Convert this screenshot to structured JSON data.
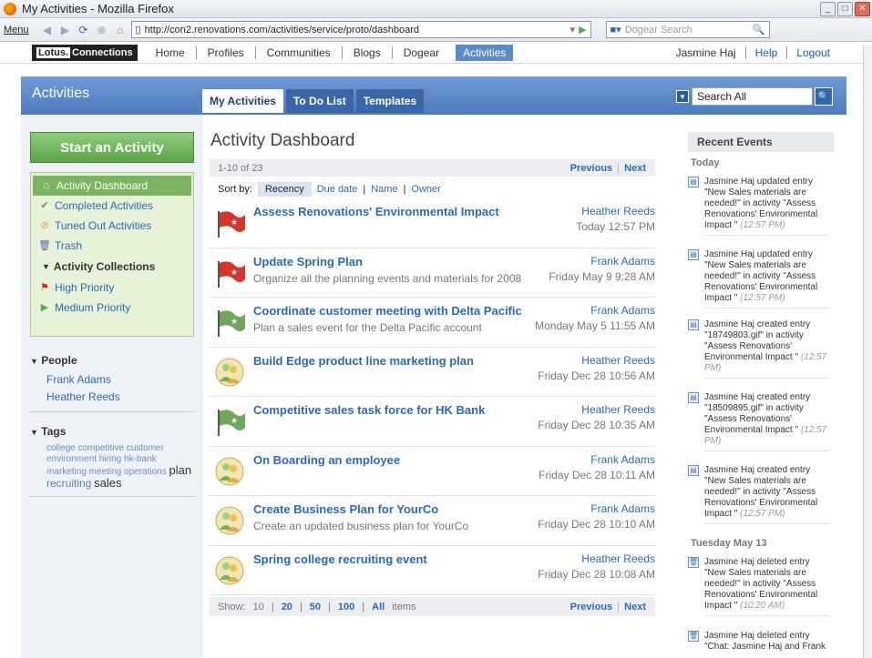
{
  "window": {
    "title": "My Activities - Mozilla Firefox"
  },
  "browser": {
    "menu": "Menu",
    "url": "http://con2.renovations.com/activities/service/proto/dashboard",
    "search_placeholder": "Dogear Search"
  },
  "topnav": {
    "brand_lotus": "Lotus.",
    "brand_name": "Connections",
    "items": [
      "Home",
      "Profiles",
      "Communities",
      "Blogs",
      "Dogear",
      "Activities"
    ],
    "user": "Jasmine Haj",
    "help": "Help",
    "logout": "Logout"
  },
  "banner": {
    "title": "Activities",
    "tabs": [
      "My Activities",
      "To Do List",
      "Templates"
    ],
    "search_value": "Search All"
  },
  "left": {
    "start_label": "Start an Activity",
    "nav": [
      "Activity Dashboard",
      "Completed Activities",
      "Tuned Out Activities",
      "Trash"
    ],
    "collections_header": "Activity Collections",
    "collections": [
      "High Priority",
      "Medium Priority"
    ],
    "people_header": "People",
    "people": [
      "Frank Adams",
      "Heather Reeds"
    ],
    "tags_header": "Tags",
    "tags_small": "college competitive customer environment hiring hk-bank marketing meeting operations",
    "tags_big1": "plan",
    "tags_mid": "recruiting",
    "tags_big2": "sales"
  },
  "main": {
    "title": "Activity Dashboard",
    "range": "1-10 of 23",
    "previous": "Previous",
    "next": "Next",
    "sort_label": "Sort by:",
    "sort_options": [
      "Recency",
      "Due date",
      "Name",
      "Owner"
    ],
    "rows": [
      {
        "title": "Assess Renovations' Environmental Impact",
        "desc": "",
        "owner": "Heather Reeds",
        "date": "Today 12:57 PM",
        "icon": "red-flag"
      },
      {
        "title": "Update Spring Plan",
        "desc": "Organize all the planning events and materials for 2008",
        "owner": "Frank Adams",
        "date": "Friday May 9 9:28 AM",
        "icon": "red-flag"
      },
      {
        "title": "Coordinate customer meeting with Delta Pacific",
        "desc": "Plan a sales event for the Delta Pacific account",
        "owner": "Frank Adams",
        "date": "Monday May 5 11:55 AM",
        "icon": "green-flag"
      },
      {
        "title": "Build Edge product line marketing plan",
        "desc": "",
        "owner": "Heather Reeds",
        "date": "Friday Dec 28 10:56 AM",
        "icon": "people"
      },
      {
        "title": "Competitive sales task force for HK Bank",
        "desc": "",
        "owner": "Heather Reeds",
        "date": "Friday Dec 28 10:35 AM",
        "icon": "green-flag"
      },
      {
        "title": "On Boarding an employee",
        "desc": "",
        "owner": "Frank Adams",
        "date": "Friday Dec 28 10:11 AM",
        "icon": "people"
      },
      {
        "title": "Create Business Plan for YourCo",
        "desc": "Create an updated business plan for YourCo",
        "owner": "Frank Adams",
        "date": "Friday Dec 28 10:10 AM",
        "icon": "people"
      },
      {
        "title": "Spring college recruiting event",
        "desc": "",
        "owner": "Heather Reeds",
        "date": "Friday Dec 28 10:08 AM",
        "icon": "people"
      }
    ],
    "show_label": "Show:",
    "show_options": [
      "10",
      "20",
      "50",
      "100",
      "All"
    ],
    "items_label": "items"
  },
  "events": {
    "header": "Recent Events",
    "today": "Today",
    "tuesday": "Tuesday May 13",
    "list": [
      {
        "text": "Jasmine Haj updated entry \"New Sales materials are needed!\" in activity \"Assess Renovations' Environmental Impact \"",
        "time": "(12:57 PM)"
      },
      {
        "text": "Jasmine Haj updated entry \"New Sales materials are needed!\" in activity \"Assess Renovations' Environmental Impact \"",
        "time": "(12:57 PM)"
      },
      {
        "text": "Jasmine Haj created entry \"18749803.gif\" in activity \"Assess Renovations' Environmental Impact \"",
        "time": "(12:57 PM)"
      },
      {
        "text": "Jasmine Haj created entry \"18509895.gif\" in activity \"Assess Renovations' Environmental Impact \"",
        "time": "(12:57 PM)"
      },
      {
        "text": "Jasmine Haj created entry \"New Sales materials are needed!\" in activity \"Assess Renovations' Environmental Impact \"",
        "time": "(12:57 PM)"
      },
      {
        "text": "Jasmine Haj deleted entry \"New Sales materials are needed!\" in activity \"Assess Renovations' Environmental Impact \"",
        "time": "(10:20 AM)"
      },
      {
        "text": "Jasmine Haj deleted entry \"Chat: Jasmine Haj and Frank",
        "time": ""
      }
    ]
  }
}
